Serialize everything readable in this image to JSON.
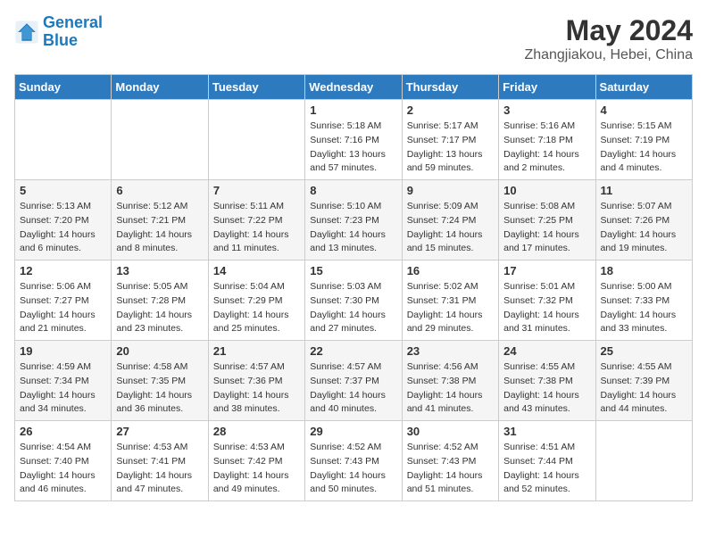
{
  "logo": {
    "line1": "General",
    "line2": "Blue"
  },
  "title": "May 2024",
  "location": "Zhangjiakou, Hebei, China",
  "days_header": [
    "Sunday",
    "Monday",
    "Tuesday",
    "Wednesday",
    "Thursday",
    "Friday",
    "Saturday"
  ],
  "weeks": [
    [
      {
        "day": "",
        "info": ""
      },
      {
        "day": "",
        "info": ""
      },
      {
        "day": "",
        "info": ""
      },
      {
        "day": "1",
        "info": "Sunrise: 5:18 AM\nSunset: 7:16 PM\nDaylight: 13 hours and 57 minutes."
      },
      {
        "day": "2",
        "info": "Sunrise: 5:17 AM\nSunset: 7:17 PM\nDaylight: 13 hours and 59 minutes."
      },
      {
        "day": "3",
        "info": "Sunrise: 5:16 AM\nSunset: 7:18 PM\nDaylight: 14 hours and 2 minutes."
      },
      {
        "day": "4",
        "info": "Sunrise: 5:15 AM\nSunset: 7:19 PM\nDaylight: 14 hours and 4 minutes."
      }
    ],
    [
      {
        "day": "5",
        "info": "Sunrise: 5:13 AM\nSunset: 7:20 PM\nDaylight: 14 hours and 6 minutes."
      },
      {
        "day": "6",
        "info": "Sunrise: 5:12 AM\nSunset: 7:21 PM\nDaylight: 14 hours and 8 minutes."
      },
      {
        "day": "7",
        "info": "Sunrise: 5:11 AM\nSunset: 7:22 PM\nDaylight: 14 hours and 11 minutes."
      },
      {
        "day": "8",
        "info": "Sunrise: 5:10 AM\nSunset: 7:23 PM\nDaylight: 14 hours and 13 minutes."
      },
      {
        "day": "9",
        "info": "Sunrise: 5:09 AM\nSunset: 7:24 PM\nDaylight: 14 hours and 15 minutes."
      },
      {
        "day": "10",
        "info": "Sunrise: 5:08 AM\nSunset: 7:25 PM\nDaylight: 14 hours and 17 minutes."
      },
      {
        "day": "11",
        "info": "Sunrise: 5:07 AM\nSunset: 7:26 PM\nDaylight: 14 hours and 19 minutes."
      }
    ],
    [
      {
        "day": "12",
        "info": "Sunrise: 5:06 AM\nSunset: 7:27 PM\nDaylight: 14 hours and 21 minutes."
      },
      {
        "day": "13",
        "info": "Sunrise: 5:05 AM\nSunset: 7:28 PM\nDaylight: 14 hours and 23 minutes."
      },
      {
        "day": "14",
        "info": "Sunrise: 5:04 AM\nSunset: 7:29 PM\nDaylight: 14 hours and 25 minutes."
      },
      {
        "day": "15",
        "info": "Sunrise: 5:03 AM\nSunset: 7:30 PM\nDaylight: 14 hours and 27 minutes."
      },
      {
        "day": "16",
        "info": "Sunrise: 5:02 AM\nSunset: 7:31 PM\nDaylight: 14 hours and 29 minutes."
      },
      {
        "day": "17",
        "info": "Sunrise: 5:01 AM\nSunset: 7:32 PM\nDaylight: 14 hours and 31 minutes."
      },
      {
        "day": "18",
        "info": "Sunrise: 5:00 AM\nSunset: 7:33 PM\nDaylight: 14 hours and 33 minutes."
      }
    ],
    [
      {
        "day": "19",
        "info": "Sunrise: 4:59 AM\nSunset: 7:34 PM\nDaylight: 14 hours and 34 minutes."
      },
      {
        "day": "20",
        "info": "Sunrise: 4:58 AM\nSunset: 7:35 PM\nDaylight: 14 hours and 36 minutes."
      },
      {
        "day": "21",
        "info": "Sunrise: 4:57 AM\nSunset: 7:36 PM\nDaylight: 14 hours and 38 minutes."
      },
      {
        "day": "22",
        "info": "Sunrise: 4:57 AM\nSunset: 7:37 PM\nDaylight: 14 hours and 40 minutes."
      },
      {
        "day": "23",
        "info": "Sunrise: 4:56 AM\nSunset: 7:38 PM\nDaylight: 14 hours and 41 minutes."
      },
      {
        "day": "24",
        "info": "Sunrise: 4:55 AM\nSunset: 7:38 PM\nDaylight: 14 hours and 43 minutes."
      },
      {
        "day": "25",
        "info": "Sunrise: 4:55 AM\nSunset: 7:39 PM\nDaylight: 14 hours and 44 minutes."
      }
    ],
    [
      {
        "day": "26",
        "info": "Sunrise: 4:54 AM\nSunset: 7:40 PM\nDaylight: 14 hours and 46 minutes."
      },
      {
        "day": "27",
        "info": "Sunrise: 4:53 AM\nSunset: 7:41 PM\nDaylight: 14 hours and 47 minutes."
      },
      {
        "day": "28",
        "info": "Sunrise: 4:53 AM\nSunset: 7:42 PM\nDaylight: 14 hours and 49 minutes."
      },
      {
        "day": "29",
        "info": "Sunrise: 4:52 AM\nSunset: 7:43 PM\nDaylight: 14 hours and 50 minutes."
      },
      {
        "day": "30",
        "info": "Sunrise: 4:52 AM\nSunset: 7:43 PM\nDaylight: 14 hours and 51 minutes."
      },
      {
        "day": "31",
        "info": "Sunrise: 4:51 AM\nSunset: 7:44 PM\nDaylight: 14 hours and 52 minutes."
      },
      {
        "day": "",
        "info": ""
      }
    ]
  ]
}
